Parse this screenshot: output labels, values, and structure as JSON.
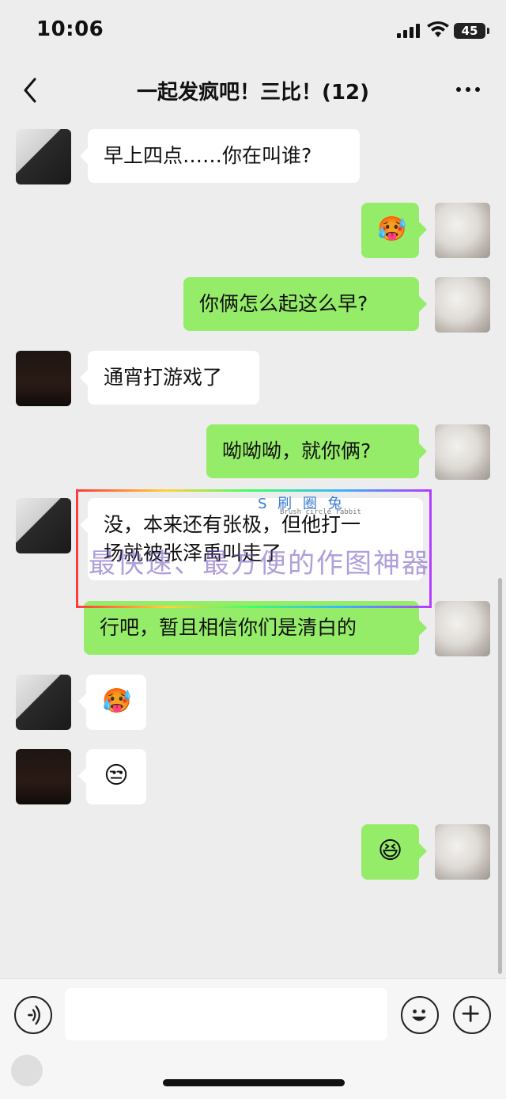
{
  "status_bar": {
    "time": "10:06",
    "battery": "45",
    "icons": [
      "cellular-signal-icon",
      "wifi-icon",
      "battery-icon"
    ]
  },
  "nav": {
    "title": "一起发疯吧！三比！(12)",
    "back_icon": "chevron-left-icon",
    "more_icon": "more-dots-icon"
  },
  "messages": [
    {
      "side": "left",
      "avatar": "avatar-a",
      "text": "早上四点……你在叫谁?"
    },
    {
      "side": "right",
      "avatar": "avatar-c",
      "emoji": "🥵"
    },
    {
      "side": "right",
      "avatar": "avatar-c",
      "text": "你俩怎么起这么早?"
    },
    {
      "side": "left",
      "avatar": "avatar-b",
      "text": "通宵打游戏了"
    },
    {
      "side": "right",
      "avatar": "avatar-c",
      "text": "呦呦呦，就你俩?"
    },
    {
      "side": "left",
      "avatar": "avatar-a",
      "text": "没，本来还有张极，但他打一\n场就被张泽禹叫走了"
    },
    {
      "side": "right",
      "avatar": "avatar-c",
      "text": "行吧，暂且相信你们是清白的"
    },
    {
      "side": "left",
      "avatar": "avatar-a",
      "emoji": "🥵"
    },
    {
      "side": "left",
      "avatar": "avatar-b",
      "emoji": "😒"
    },
    {
      "side": "right",
      "avatar": "avatar-c",
      "emoji": "😆"
    }
  ],
  "watermark": {
    "logo": "S 刷 圈 兔",
    "subtitle": "Brush circle rabbit",
    "slogan": "最快速、最方便的作图神器"
  },
  "input_bar": {
    "placeholder": "",
    "voice_icon": "voice-icon",
    "emoji_icon": "smiley-icon",
    "plus_icon": "plus-icon"
  },
  "colors": {
    "background": "#ededed",
    "bubble_green": "#95ec69",
    "bubble_white": "#ffffff"
  }
}
